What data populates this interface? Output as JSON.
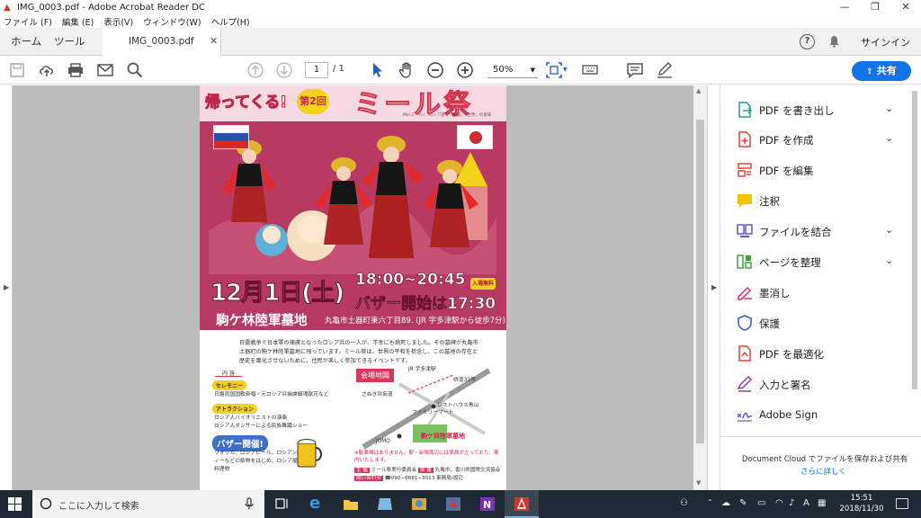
{
  "window": {
    "title": "IMG_0003.pdf - Adobe Acrobat Reader DC",
    "minimize_icon": "minimize-icon",
    "maximize_icon": "restore-icon",
    "close_icon": "close-icon"
  },
  "menu": [
    "ファイル (F)",
    "編集 (E)",
    "表示(V)",
    "ウィンドウ(W)",
    "ヘルプ(H)"
  ],
  "tabs": {
    "home": "ホーム",
    "tools": "ツール",
    "document": "IMG_0003.pdf",
    "signin": "サインイン"
  },
  "toolbar": {
    "page_current": "1",
    "page_total": "/ 1",
    "zoom": "50%",
    "share": "共有"
  },
  "flyer": {
    "banner_return": "帰ってくる!",
    "banner_badge": "第2回",
    "banner_title": "ミール祭",
    "banner_sub": "Mir(ミール)…ロシア語で「平和」「世界」の意味",
    "date": "12月1日(土)",
    "time": "18:00~20:45",
    "bazaar": "バザー開始は17:30",
    "free": "入場無料",
    "venue": "駒ケ林陸軍墓地",
    "address": "丸亀市土器町東六丁目89. (JR 宇多津駅から徒歩7分)",
    "intro": "日露戦争で日本軍の捕虜となったロシア兵の一人が、不幸にも病死しました。その墓碑が丸亀市土器町の駒ケ林陸軍墓地に残っています。ミール祭は、世界の平和を祈念し、この墓地の存在と歴史を風化させないために、住民が楽しく参加できるイベントです。",
    "section_title": "内 容",
    "ceremony": "セレモニー",
    "ceremony_text": "日露両国国歌斉唱・元ロシア兵捕虜鎮魂献花など",
    "attraction": "アトラクション",
    "attraction_text1": "ロシア人バイオリニストの演奏",
    "attraction_text2": "ロシア人ダンサーによる民族舞踊ショー",
    "bazaar_open": "バザー開催!",
    "bazaar_text": "ウォッカ、ロシアビール、ロシアンティーなどの飲物をはじめ、ロシア屋台料理物",
    "map_label": "会場地図",
    "map_jr": "JR 宇多津駅",
    "map_route": "県道33号",
    "map_oyama": "さぬき浜街道",
    "map_family": "ファミリーマート",
    "map_restaurant": "レストハウス青山",
    "map_jomo": "JOMO",
    "map_venue": "駒ケ林陸軍墓地",
    "notes": "※駐車場はありません。駅・会場周辺には係員が立っており、案内いたします。",
    "footer_org_tag": "主 催",
    "footer_org": "ミール祭実行委員会",
    "footer_support_tag": "後 援",
    "footer_support": "丸亀市、香川県国際交流協会",
    "footer_contact_tag": "問い合わせ",
    "footer_contact": "☎090−6881−3013 事務局/渡辺"
  },
  "sidepanel": {
    "items": [
      {
        "label": "PDF を書き出し",
        "icon": "export-pdf-icon",
        "chevron": true,
        "color": "#2a9d8f"
      },
      {
        "label": "PDF を作成",
        "icon": "create-pdf-icon",
        "chevron": true,
        "color": "#e0433a"
      },
      {
        "label": "PDF を編集",
        "icon": "edit-pdf-icon",
        "chevron": false,
        "color": "#e0433a"
      },
      {
        "label": "注釈",
        "icon": "comment-icon",
        "chevron": false,
        "color": "#f2c200"
      },
      {
        "label": "ファイルを結合",
        "icon": "combine-icon",
        "chevron": true,
        "color": "#6b4fd6"
      },
      {
        "label": "ページを整理",
        "icon": "organize-icon",
        "chevron": true,
        "color": "#3aa335"
      },
      {
        "label": "墨消し",
        "icon": "redact-icon",
        "chevron": false,
        "color": "#e0306c"
      },
      {
        "label": "保護",
        "icon": "protect-icon",
        "chevron": false,
        "color": "#3a5fd6"
      },
      {
        "label": "PDF を最適化",
        "icon": "optimize-icon",
        "chevron": false,
        "color": "#e0433a"
      },
      {
        "label": "入力と署名",
        "icon": "fill-sign-icon",
        "chevron": false,
        "color": "#8e44ad"
      },
      {
        "label": "Adobe Sign",
        "icon": "adobe-sign-icon",
        "chevron": false,
        "color": "#6b4fd6"
      }
    ],
    "footer_text": "Document Cloud でファイルを保存および共有",
    "footer_link": "さらに詳しく"
  },
  "taskbar": {
    "search_placeholder": "ここに入力して検索",
    "time": "15:51",
    "date": "2018/11/30",
    "ime": "A"
  }
}
